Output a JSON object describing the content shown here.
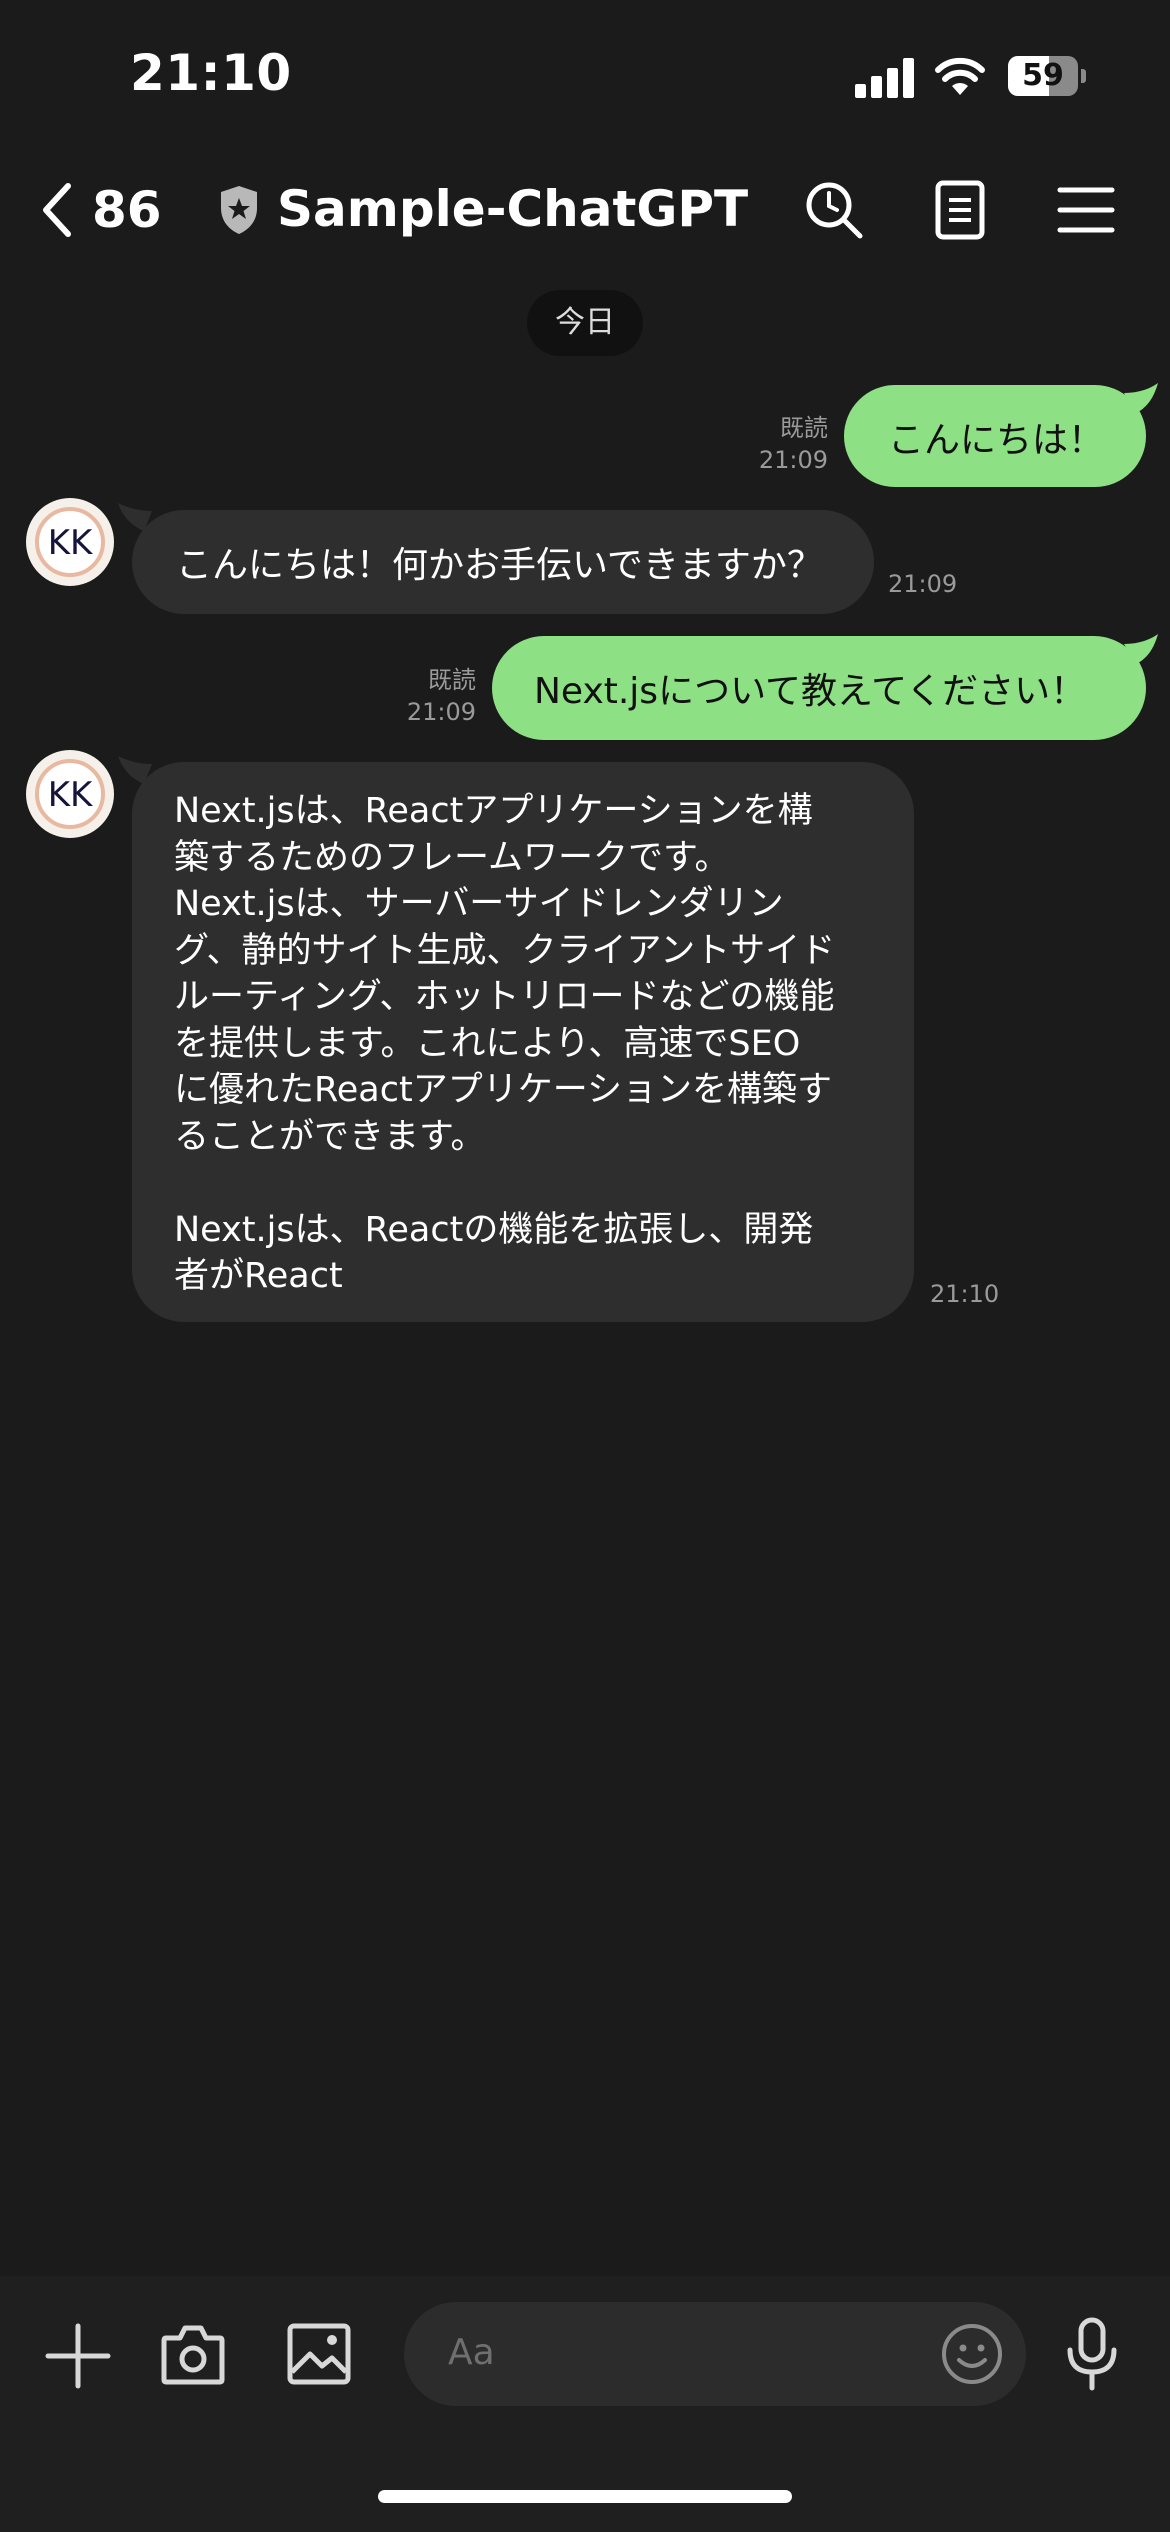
{
  "status_bar": {
    "time": "21:10",
    "battery": "59",
    "battery_level": 0.59
  },
  "header": {
    "back_count": "86",
    "title": "Sample-ChatGPT",
    "icons": [
      "search-icon",
      "notes-icon",
      "menu-icon"
    ]
  },
  "date_label": "今日",
  "messages": [
    {
      "side": "out",
      "text": "こんにちは！",
      "read": "既読",
      "time": "21:09"
    },
    {
      "side": "in",
      "text": "こんにちは！何かお手伝いできますか？",
      "time": "21:09"
    },
    {
      "side": "out",
      "text": "Next.jsについて教えてください！",
      "read": "既読",
      "time": "21:09"
    },
    {
      "side": "in",
      "lines": [
        "Next.jsは、Reactアプリケーションを構",
        "築するためのフレームワークです。",
        "Next.jsは、サーバーサイドレンダリン",
        "グ、静的サイト生成、クライアントサイド",
        "ルーティング、ホットリロードなどの機能",
        "を提供します。これにより、高速でSEO",
        "に優れたReactアプリケーションを構築す",
        "ることができます。",
        "",
        "Next.jsは、Reactの機能を拡張し、開発",
        "者がReact"
      ],
      "time": "21:10"
    }
  ],
  "input": {
    "placeholder": "Aa"
  },
  "avatar_text": "KK",
  "colors": {
    "background": "#1b1b1b",
    "outgoing_bubble": "#8de084",
    "incoming_bubble": "#2e2e2e"
  }
}
